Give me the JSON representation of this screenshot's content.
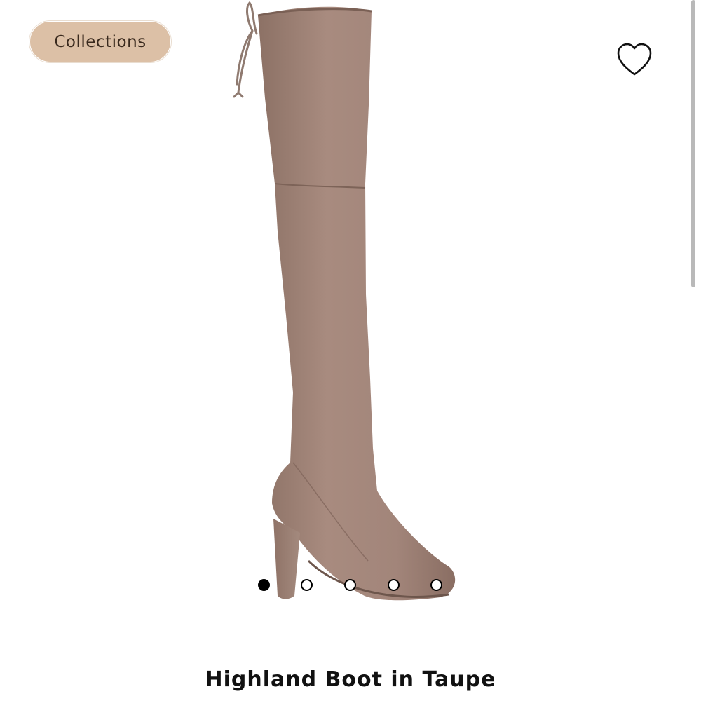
{
  "header": {
    "collections_label": "Collections"
  },
  "colors": {
    "collections_bg": "#dcc0a6",
    "boot": "#a0857a",
    "boot_shadow": "#8a6f64",
    "active_dot": "#000000"
  },
  "icons": {
    "favorite": "heart-icon"
  },
  "carousel": {
    "count": 5,
    "active_index": 0
  },
  "product": {
    "title": "Highland Boot in Taupe"
  }
}
